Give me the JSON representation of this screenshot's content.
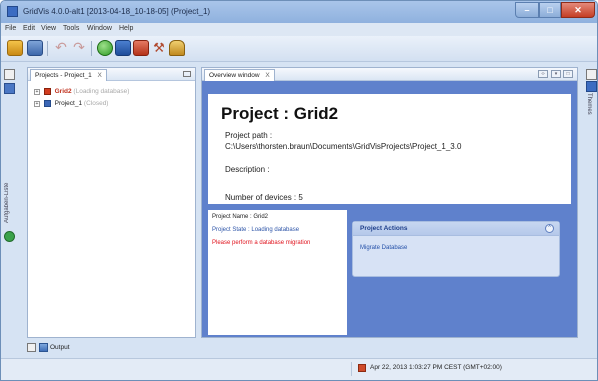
{
  "window": {
    "title": "GridVis 4.0.0-alt1 [2013-04-18_10-18-05] (Project_1)",
    "colors": {
      "titlebar": "#9dbbe6",
      "accent_blue": "#5f81cc",
      "close_red": "#c43e24"
    }
  },
  "menu": [
    "File",
    "Edit",
    "View",
    "Tools",
    "Window",
    "Help"
  ],
  "toolbar": {
    "buttons": [
      {
        "icon": "new-project-icon"
      },
      {
        "icon": "open-project-icon"
      },
      {
        "icon": "undo-icon"
      },
      {
        "icon": "redo-icon"
      },
      {
        "icon": "refresh-icon"
      },
      {
        "icon": "device-icon"
      },
      {
        "icon": "save-icon"
      },
      {
        "icon": "tools-icon"
      },
      {
        "icon": "users-icon"
      }
    ]
  },
  "left_strip": {
    "label": "Aufgaben-Liste"
  },
  "right_strip": {
    "label": "Themes"
  },
  "projects_panel": {
    "tab_label": "Projects - Project_1",
    "tab_close": "X",
    "items": [
      {
        "name": "Grid2",
        "status": "(Loading database)"
      },
      {
        "name": "Project_1",
        "status": "(Closed)"
      }
    ]
  },
  "overview_panel": {
    "tab_label": "Overview window",
    "tab_close": "X",
    "title": "Project : Grid2",
    "path_label": "Project path :",
    "path_value": "C:\\Users\\thorsten.braun\\Documents\\GridVisProjects\\Project_1_3.0",
    "description_label": "Description :",
    "devices_label": "Number of devices : 5",
    "project_name": "Project Name : Grid2",
    "project_state": "Project State : Loading database",
    "migration_warning": "Please perform a database migration",
    "actions_title": "Project Actions",
    "actions_collapse": "^",
    "actions_link": "Migrate Database"
  },
  "output": {
    "label": "Output"
  },
  "status": {
    "timestamp": "Apr 22, 2013 1:03:27 PM CEST (GMT+02:00)"
  }
}
